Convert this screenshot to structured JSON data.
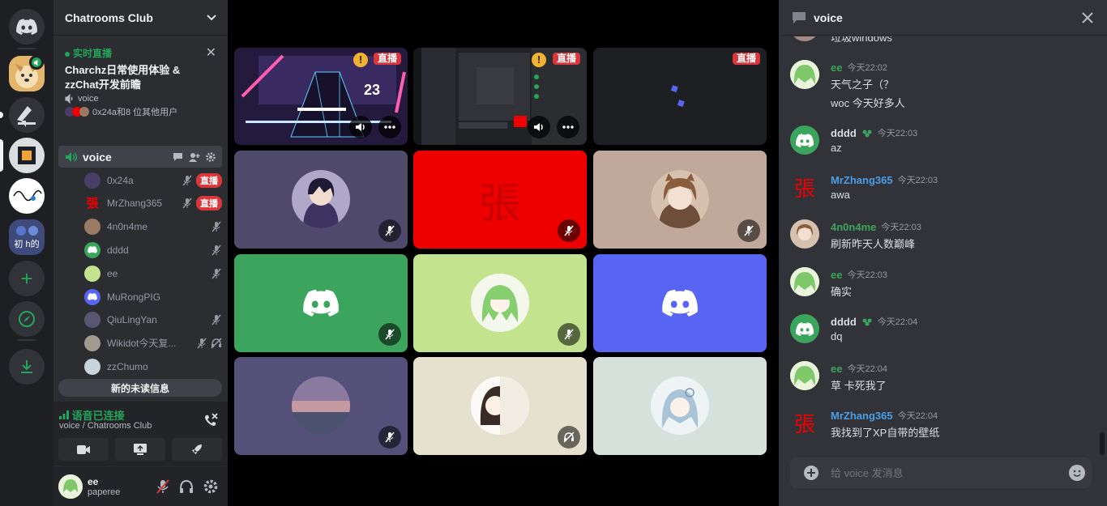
{
  "colors": {
    "green": "#23a55a",
    "red": "#da373c",
    "blurple": "#5865f2",
    "link_blue": "#4a9ee8",
    "member_green": "#3ba55d"
  },
  "rail": {
    "servers": [
      {
        "name": "discord-home-icon"
      },
      {
        "name": "shiba-server-icon"
      },
      {
        "name": "chatrooms-server-icon"
      },
      {
        "name": "orange-square-server-icon"
      },
      {
        "name": "sketch-server-icon"
      },
      {
        "name": "anime-folder-server-icon",
        "text": "初 h的"
      },
      {
        "name": "add-server-icon"
      },
      {
        "name": "explore-icon"
      },
      {
        "name": "download-icon"
      }
    ]
  },
  "guild": {
    "name": "Chatrooms Club"
  },
  "event": {
    "live_label": "实时直播",
    "title": "Charchz日常使用体验 & zzChat开发前瞻",
    "channel": "voice",
    "attendees": "0x24a和8 位其他用户"
  },
  "voice_channel": {
    "name": "voice"
  },
  "voice_members": [
    {
      "name": "0x24a",
      "live": "直播",
      "avatar": "#4a3d6a"
    },
    {
      "name": "MrZhang365",
      "live": "直播",
      "avatar": "#2b2d31"
    },
    {
      "name": "4n0n4me",
      "live": "",
      "avatar": "#9a7a62"
    },
    {
      "name": "dddd",
      "live": "",
      "avatar": "#3ba55d"
    },
    {
      "name": "ee",
      "live": "",
      "avatar": "#c4e38e"
    },
    {
      "name": "MuRongPIG",
      "live": "",
      "avatar": "#5865f2"
    },
    {
      "name": "QiuLingYan",
      "live": "",
      "avatar": "#5a5570"
    },
    {
      "name": "Wikidot今天复...",
      "live": "",
      "avatar": "#a39a8f"
    },
    {
      "name": "zzChumo",
      "live": "",
      "avatar": "#c8d4dc"
    }
  ],
  "unread_label": "新的未读信息",
  "voice_panel": {
    "status": "语音已连接",
    "path": "voice / Chatrooms Club"
  },
  "user_panel": {
    "username": "ee",
    "status": "paperee"
  },
  "stage": {
    "live_label": "直播",
    "tiles": [
      {
        "name": "tile-game-stream",
        "bg": "#1a1430",
        "live": true,
        "game": "23"
      },
      {
        "name": "tile-desktop-stream",
        "bg": "#1e1f22",
        "live": true
      },
      {
        "name": "tile-blank-stream",
        "bg": "#1e1f22",
        "live": true
      },
      {
        "name": "tile-0x24a",
        "bg": "#4f4a6b",
        "avatar": "#3a3556"
      },
      {
        "name": "tile-mrzhang365",
        "bg": "#ee0000",
        "avatar": "#ee0000",
        "glyph": "張"
      },
      {
        "name": "tile-4n0n4me",
        "bg": "#c0a99b",
        "avatar": "#8a6d59"
      },
      {
        "name": "tile-dddd",
        "bg": "#3ba55d",
        "avatar": "#3ba55d",
        "discord": true
      },
      {
        "name": "tile-ee",
        "bg": "#c4e38e",
        "avatar": "#ffffff"
      },
      {
        "name": "tile-murongpig",
        "bg": "#5865f2",
        "avatar": "#5865f2",
        "discord": true
      },
      {
        "name": "tile-qiulingyan",
        "bg": "#55507a",
        "avatar": "#7a6a86"
      },
      {
        "name": "tile-wikidot",
        "bg": "#e6e1cf",
        "avatar": "#ffffff"
      },
      {
        "name": "tile-zzchumo",
        "bg": "#d7e1db",
        "avatar": "#e4ecf0"
      }
    ]
  },
  "chat": {
    "title": "voice",
    "partial_top": "垃圾windows",
    "messages": [
      {
        "author": "ee",
        "color": "#3ba55d",
        "time": "今天22:02",
        "lines": [
          "天气之子（？",
          "woc 今天好多人"
        ],
        "avatar": "#c4e38e"
      },
      {
        "author": "dddd",
        "color": "#dbdee1",
        "time": "今天22:03",
        "lines": [
          "az"
        ],
        "avatar": "#3ba55d",
        "discord": true,
        "badge": true
      },
      {
        "author": "MrZhang365",
        "color": "#4a9ee8",
        "time": "今天22:03",
        "lines": [
          "awa"
        ],
        "avatar": "#313338",
        "glyph": "張"
      },
      {
        "author": "4n0n4me",
        "color": "#3ba55d",
        "time": "今天22:03",
        "lines": [
          "刷新昨天人数巅峰"
        ],
        "avatar": "#9a7a62"
      },
      {
        "author": "ee",
        "color": "#3ba55d",
        "time": "今天22:03",
        "lines": [
          "确实"
        ],
        "avatar": "#c4e38e"
      },
      {
        "author": "dddd",
        "color": "#dbdee1",
        "time": "今天22:04",
        "lines": [
          "dq"
        ],
        "avatar": "#3ba55d",
        "discord": true,
        "badge": true
      },
      {
        "author": "ee",
        "color": "#3ba55d",
        "time": "今天22:04",
        "lines": [
          "草 卡死我了"
        ],
        "avatar": "#c4e38e"
      },
      {
        "author": "MrZhang365",
        "color": "#4a9ee8",
        "time": "今天22:04",
        "lines": [
          "我找到了XP自带的壁纸"
        ],
        "avatar": "#313338",
        "glyph": "張"
      }
    ],
    "composer_placeholder": "给 voice 发消息"
  }
}
